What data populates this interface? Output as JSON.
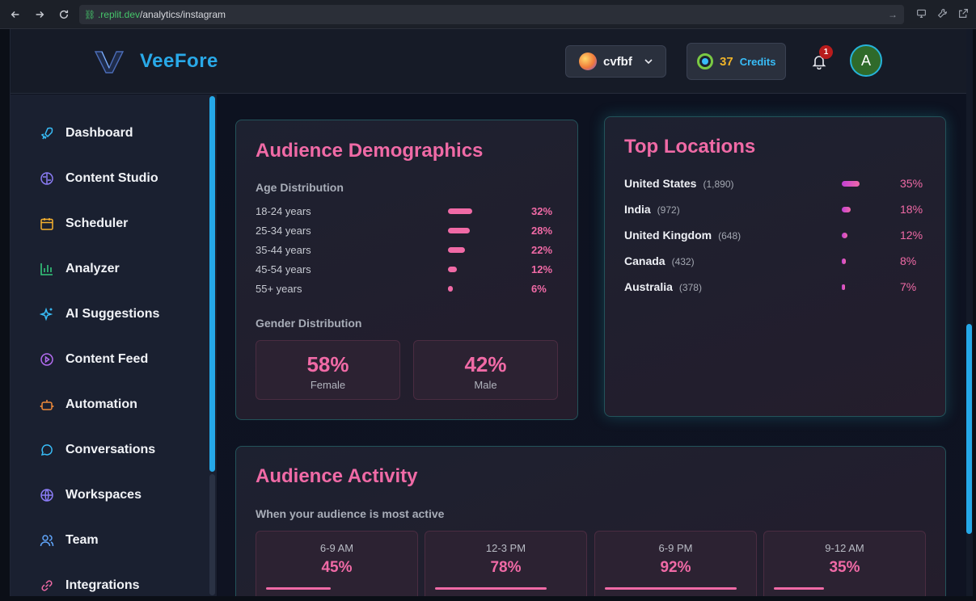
{
  "browser": {
    "url_domain": ".replit.dev",
    "url_path": "/analytics/instagram"
  },
  "header": {
    "logo_text": "VeeFore",
    "workspace_name": "cvfbf",
    "credits_count": "37",
    "credits_label": "Credits",
    "notification_count": "1",
    "avatar_initial": "A"
  },
  "sidebar": {
    "items": [
      {
        "label": "Dashboard",
        "icon": "rocket-icon"
      },
      {
        "label": "Content Studio",
        "icon": "brain-icon"
      },
      {
        "label": "Scheduler",
        "icon": "calendar-icon"
      },
      {
        "label": "Analyzer",
        "icon": "bar-chart-icon"
      },
      {
        "label": "AI Suggestions",
        "icon": "sparkles-icon"
      },
      {
        "label": "Content Feed",
        "icon": "play-circle-icon"
      },
      {
        "label": "Automation",
        "icon": "bot-icon"
      },
      {
        "label": "Conversations",
        "icon": "chat-bubble-icon"
      },
      {
        "label": "Workspaces",
        "icon": "globe-icon"
      },
      {
        "label": "Team",
        "icon": "users-icon"
      },
      {
        "label": "Integrations",
        "icon": "link-icon"
      }
    ]
  },
  "demographics": {
    "title": "Audience Demographics",
    "age_label": "Age Distribution",
    "ages": [
      {
        "label": "18-24 years",
        "pct": "32%",
        "value": 32
      },
      {
        "label": "25-34 years",
        "pct": "28%",
        "value": 28
      },
      {
        "label": "35-44 years",
        "pct": "22%",
        "value": 22
      },
      {
        "label": "45-54 years",
        "pct": "12%",
        "value": 12
      },
      {
        "label": "55+ years",
        "pct": "6%",
        "value": 6
      }
    ],
    "gender_label": "Gender Distribution",
    "female_pct": "58%",
    "female_label": "Female",
    "male_pct": "42%",
    "male_label": "Male"
  },
  "locations": {
    "title": "Top Locations",
    "items": [
      {
        "name": "United States",
        "count": "(1,890)",
        "pct": "35%",
        "value": 35
      },
      {
        "name": "India",
        "count": "(972)",
        "pct": "18%",
        "value": 18
      },
      {
        "name": "United Kingdom",
        "count": "(648)",
        "pct": "12%",
        "value": 12
      },
      {
        "name": "Canada",
        "count": "(432)",
        "pct": "8%",
        "value": 8
      },
      {
        "name": "Australia",
        "count": "(378)",
        "pct": "7%",
        "value": 7
      }
    ]
  },
  "activity": {
    "title": "Audience Activity",
    "subtitle": "When your audience is most active",
    "slots": [
      {
        "time": "6-9 AM",
        "pct": "45%",
        "value": 45
      },
      {
        "time": "12-3 PM",
        "pct": "78%",
        "value": 78
      },
      {
        "time": "6-9 PM",
        "pct": "92%",
        "value": 92
      },
      {
        "time": "9-12 AM",
        "pct": "35%",
        "value": 35
      }
    ]
  },
  "colors": {
    "accent_pink": "#f06aa6",
    "accent_blue": "#29a9e8"
  }
}
